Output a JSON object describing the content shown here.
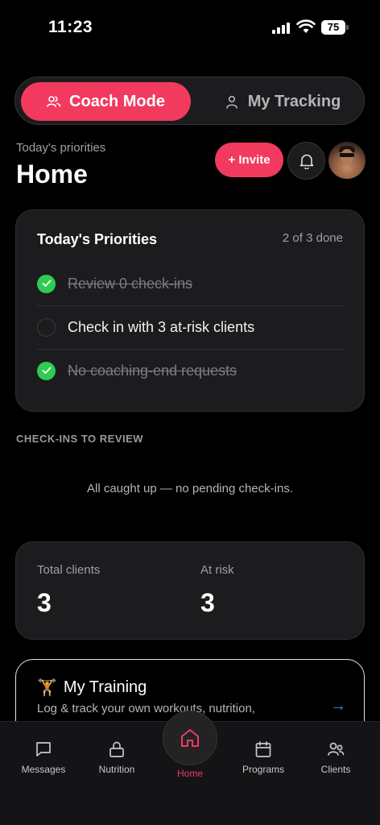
{
  "status_bar": {
    "time": "11:23",
    "battery": "75"
  },
  "mode_switch": {
    "coach_label": "Coach Mode",
    "tracking_label": "My Tracking"
  },
  "header": {
    "subtitle": "Today's priorities",
    "title": "Home",
    "invite_label": "+ Invite"
  },
  "priorities": {
    "title": "Today's Priorities",
    "count": "2 of 3 done",
    "items": [
      {
        "label": "Review 0 check-ins",
        "done": true
      },
      {
        "label": "Check in with 3 at-risk clients",
        "done": false
      },
      {
        "label": "No coaching-end requests",
        "done": true
      }
    ]
  },
  "checkins": {
    "section_label": "CHECK-INS TO REVIEW",
    "empty_message": "All caught up — no pending check-ins."
  },
  "stats": {
    "total_label": "Total clients",
    "total_value": "3",
    "risk_label": "At risk",
    "risk_value": "3"
  },
  "training": {
    "emoji": "🏋️",
    "title": "My Training",
    "description": "Log & track your own workouts, nutrition,",
    "arrow": "→"
  },
  "nav": {
    "messages": "Messages",
    "nutrition": "Nutrition",
    "home": "Home",
    "programs": "Programs",
    "clients": "Clients"
  },
  "colors": {
    "accent": "#f23a5e",
    "success": "#2ecc52",
    "link": "#2f7bff",
    "card": "#1c1c1e"
  }
}
